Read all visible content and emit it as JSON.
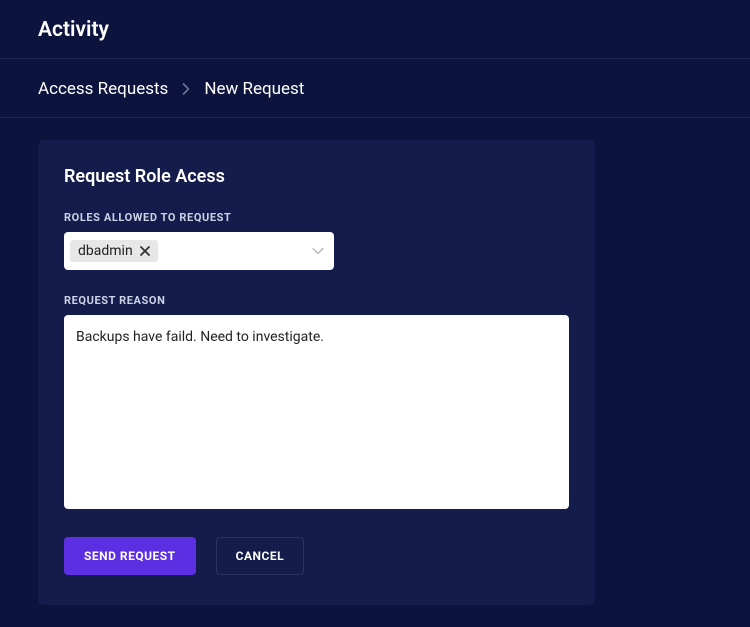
{
  "header": {
    "title": "Activity"
  },
  "breadcrumb": {
    "link": "Access Requests",
    "current": "New Request"
  },
  "card": {
    "title": "Request Role Acess",
    "roles_label": "ROLES ALLOWED TO REQUEST",
    "selected_role": "dbadmin",
    "reason_label": "REQUEST REASON",
    "reason_value": "Backups have faild. Need to investigate."
  },
  "buttons": {
    "send": "SEND REQUEST",
    "cancel": "CANCEL"
  }
}
